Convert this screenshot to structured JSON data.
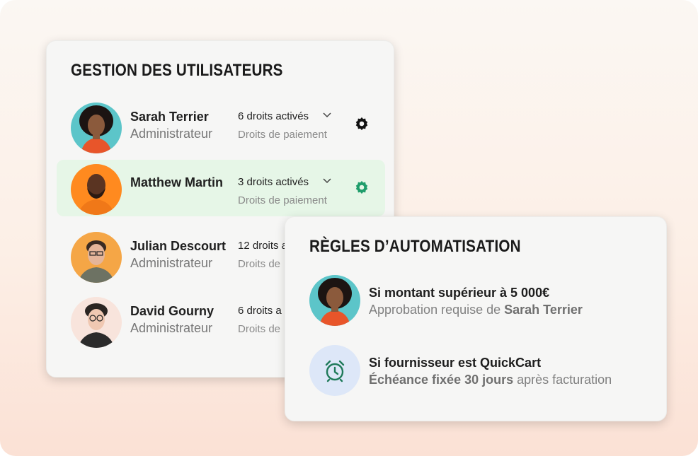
{
  "colors": {
    "accent_green": "#1f9d6b",
    "highlight_row": "#e6f6e7",
    "clock_bg": "#dde7f8"
  },
  "users_panel": {
    "title": "GESTION DES UTILISATEURS",
    "users": [
      {
        "name": "Sarah Terrier",
        "role": "Administrateur",
        "rights": "6 droits activés",
        "permission": "Droits de paiement",
        "icon": "gear-icon"
      },
      {
        "name": "Matthew Martin",
        "role": "",
        "rights": "3 droits activés",
        "permission": "Droits de paiement",
        "icon": "gear-icon",
        "selected": true
      },
      {
        "name": "Julian Descourt",
        "role": "Administrateur",
        "rights": "12 droits a",
        "permission": "Droits de"
      },
      {
        "name": "David Gourny",
        "role": "Administrateur",
        "rights": "6 droits a",
        "permission": "Droits de"
      }
    ]
  },
  "rules_panel": {
    "title": "RÈGLES D’AUTOMATISATION",
    "rules": [
      {
        "title": "Si montant supérieur à 5 000€",
        "desc_prefix": "Approbation requise de ",
        "desc_bold": "Sarah Terrier",
        "desc_suffix": ""
      },
      {
        "title": "Si fournisseur est QuickCart",
        "desc_prefix": "",
        "desc_bold": "Échéance fixée 30 jours",
        "desc_suffix": " après facturation",
        "icon": "alarm-clock-icon"
      }
    ]
  }
}
